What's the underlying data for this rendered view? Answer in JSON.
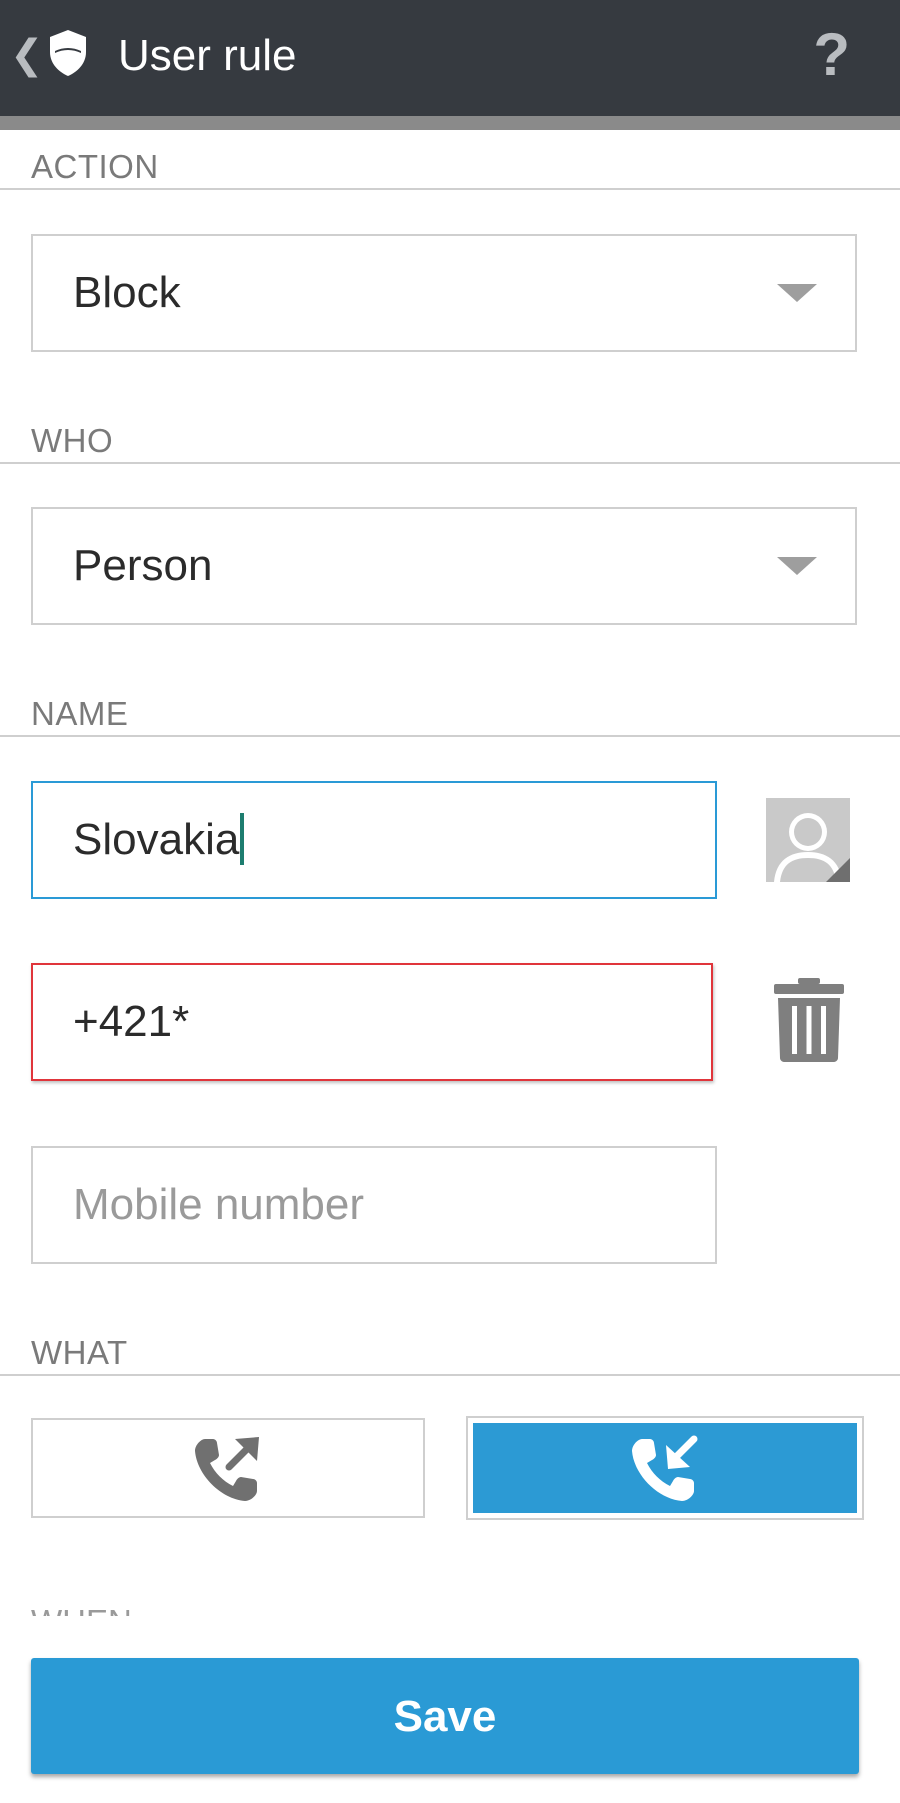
{
  "header": {
    "title": "User rule",
    "back_icon": "chevron-left-icon",
    "logo_icon": "shield-icon",
    "help_label": "?"
  },
  "sections": {
    "action": "ACTION",
    "who": "WHO",
    "name": "NAME",
    "what": "WHAT",
    "when_partial": "WHEN"
  },
  "action_select": {
    "value": "Block"
  },
  "who_select": {
    "value": "Person"
  },
  "name_field": {
    "value": "Slovakia"
  },
  "number_field": {
    "value": "+421*"
  },
  "mobile_field": {
    "placeholder": "Mobile number"
  },
  "what_buttons": [
    {
      "icon": "outgoing-call-icon",
      "selected": false
    },
    {
      "icon": "incoming-call-icon",
      "selected": true
    }
  ],
  "save_label": "Save",
  "colors": {
    "accent": "#2a9ad5",
    "appbar": "#363a40",
    "error": "#e0353b"
  }
}
